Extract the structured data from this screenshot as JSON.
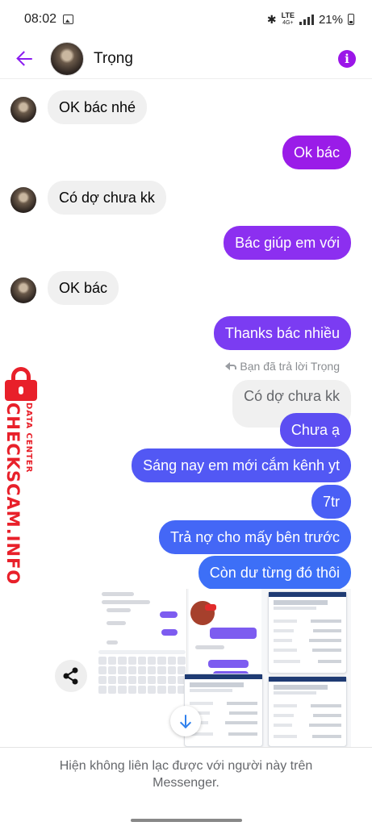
{
  "status_bar": {
    "time": "08:02",
    "network": "LTE",
    "network_sub": "4G+",
    "battery": "21%"
  },
  "header": {
    "name": "Trọng"
  },
  "messages": [
    {
      "side": "in",
      "text": "OK bác nhé",
      "avatar": true
    },
    {
      "side": "out",
      "text": "Ok bác",
      "color": "#9a1ce8"
    },
    {
      "side": "in",
      "text": "Có dợ chưa kk",
      "avatar": true
    },
    {
      "side": "out",
      "text": "Bác giúp em với",
      "color": "#8c2ff0"
    },
    {
      "side": "in",
      "text": "OK bác",
      "avatar": true
    },
    {
      "side": "out",
      "text": "Thanks bác nhiều",
      "color": "#7b3cf2"
    }
  ],
  "reply": {
    "label": "Bạn đã trả lời Trọng",
    "quoted": "Có dợ chưa kk"
  },
  "out_messages_2": [
    {
      "text": "Chưa ạ",
      "color": "#5c4ef2"
    },
    {
      "text": "Sáng nay em mới cắm kênh yt",
      "color": "#5258f4"
    },
    {
      "text": "7tr",
      "color": "#4a5ff5"
    },
    {
      "text": "Trả nợ cho mấy bên trước",
      "color": "#4467f6"
    },
    {
      "text": "Còn dư từng đó thôi",
      "color": "#3d6ff7"
    }
  ],
  "watermark": {
    "big": "CHECKSCAM.INFO",
    "small": "DATA CENTER",
    "color": "#e8202a"
  },
  "icons": {
    "back": "back-arrow-icon",
    "info": "info-icon",
    "share": "share-icon",
    "scroll": "arrow-down-icon",
    "reply": "reply-icon"
  },
  "footer": {
    "text": "Hiện không liên lạc được với người này trên\nMessenger."
  }
}
